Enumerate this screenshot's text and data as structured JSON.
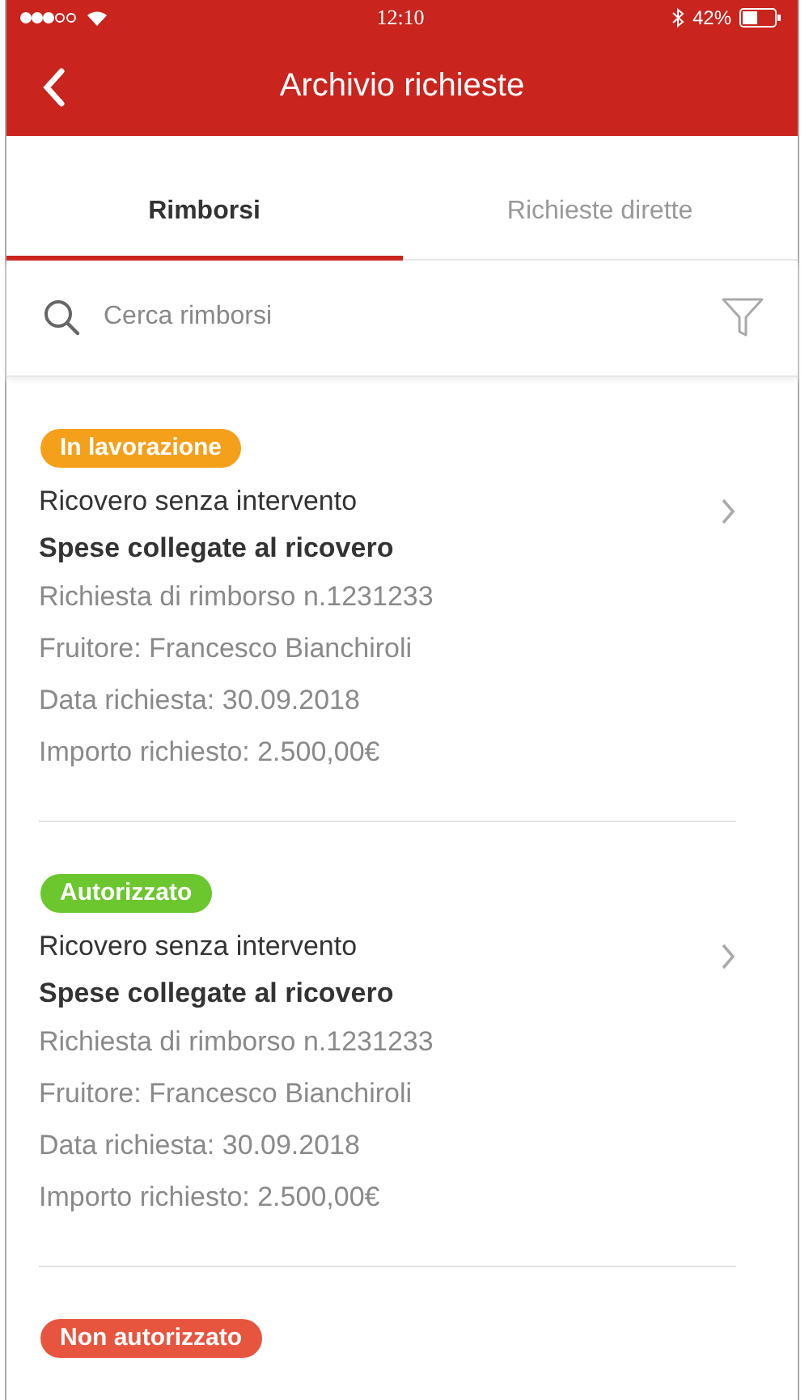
{
  "status_bar": {
    "time": "12:10",
    "battery_text": "42%"
  },
  "header": {
    "title": "Archivio richieste"
  },
  "tabs": [
    {
      "label": "Rimborsi",
      "selected": true
    },
    {
      "label": "Richieste dirette",
      "selected": false
    }
  ],
  "search": {
    "placeholder": "Cerca rimborsi"
  },
  "requests": [
    {
      "status": "In lavorazione",
      "color": "#f5a01a",
      "title": "Ricovero senza intervento",
      "subtitle": "Spese collegate al ricovero",
      "details": [
        "Richiesta di rimborso n.1231233",
        "Fruitore: Francesco Bianchiroli",
        "Data richiesta: 30.09.2018",
        "Importo richiesto: 2.500,00€"
      ]
    },
    {
      "status": "Autorizzato",
      "color": "#6cc62e",
      "title": "Ricovero senza intervento",
      "subtitle": "Spese collegate al ricovero",
      "details": [
        "Richiesta di rimborso n.1231233",
        "Fruitore: Francesco Bianchiroli",
        "Data richiesta: 30.09.2018",
        "Importo richiesto: 2.500,00€"
      ]
    },
    {
      "status": "Non autorizzato",
      "color": "#e8553f"
    }
  ]
}
